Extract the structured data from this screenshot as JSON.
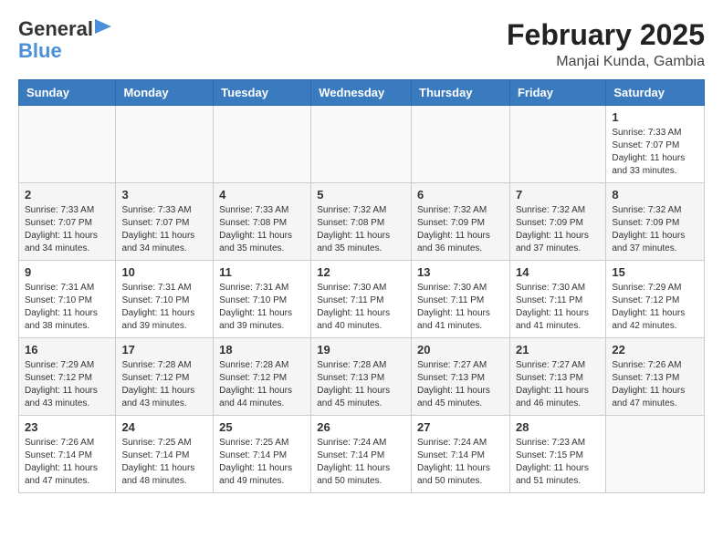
{
  "header": {
    "logo_line1": "General",
    "logo_line2": "Blue",
    "title": "February 2025",
    "subtitle": "Manjai Kunda, Gambia"
  },
  "days_of_week": [
    "Sunday",
    "Monday",
    "Tuesday",
    "Wednesday",
    "Thursday",
    "Friday",
    "Saturday"
  ],
  "weeks": [
    [
      {
        "day": "",
        "content": ""
      },
      {
        "day": "",
        "content": ""
      },
      {
        "day": "",
        "content": ""
      },
      {
        "day": "",
        "content": ""
      },
      {
        "day": "",
        "content": ""
      },
      {
        "day": "",
        "content": ""
      },
      {
        "day": "1",
        "content": "Sunrise: 7:33 AM\nSunset: 7:07 PM\nDaylight: 11 hours and 33 minutes."
      }
    ],
    [
      {
        "day": "2",
        "content": "Sunrise: 7:33 AM\nSunset: 7:07 PM\nDaylight: 11 hours and 34 minutes."
      },
      {
        "day": "3",
        "content": "Sunrise: 7:33 AM\nSunset: 7:07 PM\nDaylight: 11 hours and 34 minutes."
      },
      {
        "day": "4",
        "content": "Sunrise: 7:33 AM\nSunset: 7:08 PM\nDaylight: 11 hours and 35 minutes."
      },
      {
        "day": "5",
        "content": "Sunrise: 7:32 AM\nSunset: 7:08 PM\nDaylight: 11 hours and 35 minutes."
      },
      {
        "day": "6",
        "content": "Sunrise: 7:32 AM\nSunset: 7:09 PM\nDaylight: 11 hours and 36 minutes."
      },
      {
        "day": "7",
        "content": "Sunrise: 7:32 AM\nSunset: 7:09 PM\nDaylight: 11 hours and 37 minutes."
      },
      {
        "day": "8",
        "content": "Sunrise: 7:32 AM\nSunset: 7:09 PM\nDaylight: 11 hours and 37 minutes."
      }
    ],
    [
      {
        "day": "9",
        "content": "Sunrise: 7:31 AM\nSunset: 7:10 PM\nDaylight: 11 hours and 38 minutes."
      },
      {
        "day": "10",
        "content": "Sunrise: 7:31 AM\nSunset: 7:10 PM\nDaylight: 11 hours and 39 minutes."
      },
      {
        "day": "11",
        "content": "Sunrise: 7:31 AM\nSunset: 7:10 PM\nDaylight: 11 hours and 39 minutes."
      },
      {
        "day": "12",
        "content": "Sunrise: 7:30 AM\nSunset: 7:11 PM\nDaylight: 11 hours and 40 minutes."
      },
      {
        "day": "13",
        "content": "Sunrise: 7:30 AM\nSunset: 7:11 PM\nDaylight: 11 hours and 41 minutes."
      },
      {
        "day": "14",
        "content": "Sunrise: 7:30 AM\nSunset: 7:11 PM\nDaylight: 11 hours and 41 minutes."
      },
      {
        "day": "15",
        "content": "Sunrise: 7:29 AM\nSunset: 7:12 PM\nDaylight: 11 hours and 42 minutes."
      }
    ],
    [
      {
        "day": "16",
        "content": "Sunrise: 7:29 AM\nSunset: 7:12 PM\nDaylight: 11 hours and 43 minutes."
      },
      {
        "day": "17",
        "content": "Sunrise: 7:28 AM\nSunset: 7:12 PM\nDaylight: 11 hours and 43 minutes."
      },
      {
        "day": "18",
        "content": "Sunrise: 7:28 AM\nSunset: 7:12 PM\nDaylight: 11 hours and 44 minutes."
      },
      {
        "day": "19",
        "content": "Sunrise: 7:28 AM\nSunset: 7:13 PM\nDaylight: 11 hours and 45 minutes."
      },
      {
        "day": "20",
        "content": "Sunrise: 7:27 AM\nSunset: 7:13 PM\nDaylight: 11 hours and 45 minutes."
      },
      {
        "day": "21",
        "content": "Sunrise: 7:27 AM\nSunset: 7:13 PM\nDaylight: 11 hours and 46 minutes."
      },
      {
        "day": "22",
        "content": "Sunrise: 7:26 AM\nSunset: 7:13 PM\nDaylight: 11 hours and 47 minutes."
      }
    ],
    [
      {
        "day": "23",
        "content": "Sunrise: 7:26 AM\nSunset: 7:14 PM\nDaylight: 11 hours and 47 minutes."
      },
      {
        "day": "24",
        "content": "Sunrise: 7:25 AM\nSunset: 7:14 PM\nDaylight: 11 hours and 48 minutes."
      },
      {
        "day": "25",
        "content": "Sunrise: 7:25 AM\nSunset: 7:14 PM\nDaylight: 11 hours and 49 minutes."
      },
      {
        "day": "26",
        "content": "Sunrise: 7:24 AM\nSunset: 7:14 PM\nDaylight: 11 hours and 50 minutes."
      },
      {
        "day": "27",
        "content": "Sunrise: 7:24 AM\nSunset: 7:14 PM\nDaylight: 11 hours and 50 minutes."
      },
      {
        "day": "28",
        "content": "Sunrise: 7:23 AM\nSunset: 7:15 PM\nDaylight: 11 hours and 51 minutes."
      },
      {
        "day": "",
        "content": ""
      }
    ]
  ]
}
